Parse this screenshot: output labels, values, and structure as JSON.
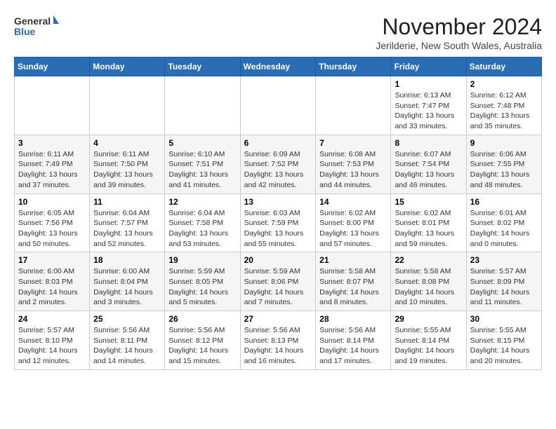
{
  "header": {
    "logo": {
      "general": "General",
      "blue": "Blue"
    },
    "title": "November 2024",
    "subtitle": "Jerilderie, New South Wales, Australia"
  },
  "calendar": {
    "days_of_week": [
      "Sunday",
      "Monday",
      "Tuesday",
      "Wednesday",
      "Thursday",
      "Friday",
      "Saturday"
    ],
    "weeks": [
      [
        {
          "day": "",
          "info": ""
        },
        {
          "day": "",
          "info": ""
        },
        {
          "day": "",
          "info": ""
        },
        {
          "day": "",
          "info": ""
        },
        {
          "day": "",
          "info": ""
        },
        {
          "day": "1",
          "info": "Sunrise: 6:13 AM\nSunset: 7:47 PM\nDaylight: 13 hours\nand 33 minutes."
        },
        {
          "day": "2",
          "info": "Sunrise: 6:12 AM\nSunset: 7:48 PM\nDaylight: 13 hours\nand 35 minutes."
        }
      ],
      [
        {
          "day": "3",
          "info": "Sunrise: 6:11 AM\nSunset: 7:49 PM\nDaylight: 13 hours\nand 37 minutes."
        },
        {
          "day": "4",
          "info": "Sunrise: 6:11 AM\nSunset: 7:50 PM\nDaylight: 13 hours\nand 39 minutes."
        },
        {
          "day": "5",
          "info": "Sunrise: 6:10 AM\nSunset: 7:51 PM\nDaylight: 13 hours\nand 41 minutes."
        },
        {
          "day": "6",
          "info": "Sunrise: 6:09 AM\nSunset: 7:52 PM\nDaylight: 13 hours\nand 42 minutes."
        },
        {
          "day": "7",
          "info": "Sunrise: 6:08 AM\nSunset: 7:53 PM\nDaylight: 13 hours\nand 44 minutes."
        },
        {
          "day": "8",
          "info": "Sunrise: 6:07 AM\nSunset: 7:54 PM\nDaylight: 13 hours\nand 46 minutes."
        },
        {
          "day": "9",
          "info": "Sunrise: 6:06 AM\nSunset: 7:55 PM\nDaylight: 13 hours\nand 48 minutes."
        }
      ],
      [
        {
          "day": "10",
          "info": "Sunrise: 6:05 AM\nSunset: 7:56 PM\nDaylight: 13 hours\nand 50 minutes."
        },
        {
          "day": "11",
          "info": "Sunrise: 6:04 AM\nSunset: 7:57 PM\nDaylight: 13 hours\nand 52 minutes."
        },
        {
          "day": "12",
          "info": "Sunrise: 6:04 AM\nSunset: 7:58 PM\nDaylight: 13 hours\nand 53 minutes."
        },
        {
          "day": "13",
          "info": "Sunrise: 6:03 AM\nSunset: 7:59 PM\nDaylight: 13 hours\nand 55 minutes."
        },
        {
          "day": "14",
          "info": "Sunrise: 6:02 AM\nSunset: 8:00 PM\nDaylight: 13 hours\nand 57 minutes."
        },
        {
          "day": "15",
          "info": "Sunrise: 6:02 AM\nSunset: 8:01 PM\nDaylight: 13 hours\nand 59 minutes."
        },
        {
          "day": "16",
          "info": "Sunrise: 6:01 AM\nSunset: 8:02 PM\nDaylight: 14 hours\nand 0 minutes."
        }
      ],
      [
        {
          "day": "17",
          "info": "Sunrise: 6:00 AM\nSunset: 8:03 PM\nDaylight: 14 hours\nand 2 minutes."
        },
        {
          "day": "18",
          "info": "Sunrise: 6:00 AM\nSunset: 8:04 PM\nDaylight: 14 hours\nand 3 minutes."
        },
        {
          "day": "19",
          "info": "Sunrise: 5:59 AM\nSunset: 8:05 PM\nDaylight: 14 hours\nand 5 minutes."
        },
        {
          "day": "20",
          "info": "Sunrise: 5:59 AM\nSunset: 8:06 PM\nDaylight: 14 hours\nand 7 minutes."
        },
        {
          "day": "21",
          "info": "Sunrise: 5:58 AM\nSunset: 8:07 PM\nDaylight: 14 hours\nand 8 minutes."
        },
        {
          "day": "22",
          "info": "Sunrise: 5:58 AM\nSunset: 8:08 PM\nDaylight: 14 hours\nand 10 minutes."
        },
        {
          "day": "23",
          "info": "Sunrise: 5:57 AM\nSunset: 8:09 PM\nDaylight: 14 hours\nand 11 minutes."
        }
      ],
      [
        {
          "day": "24",
          "info": "Sunrise: 5:57 AM\nSunset: 8:10 PM\nDaylight: 14 hours\nand 12 minutes."
        },
        {
          "day": "25",
          "info": "Sunrise: 5:56 AM\nSunset: 8:11 PM\nDaylight: 14 hours\nand 14 minutes."
        },
        {
          "day": "26",
          "info": "Sunrise: 5:56 AM\nSunset: 8:12 PM\nDaylight: 14 hours\nand 15 minutes."
        },
        {
          "day": "27",
          "info": "Sunrise: 5:56 AM\nSunset: 8:13 PM\nDaylight: 14 hours\nand 16 minutes."
        },
        {
          "day": "28",
          "info": "Sunrise: 5:56 AM\nSunset: 8:14 PM\nDaylight: 14 hours\nand 17 minutes."
        },
        {
          "day": "29",
          "info": "Sunrise: 5:55 AM\nSunset: 8:14 PM\nDaylight: 14 hours\nand 19 minutes."
        },
        {
          "day": "30",
          "info": "Sunrise: 5:55 AM\nSunset: 8:15 PM\nDaylight: 14 hours\nand 20 minutes."
        }
      ]
    ]
  }
}
